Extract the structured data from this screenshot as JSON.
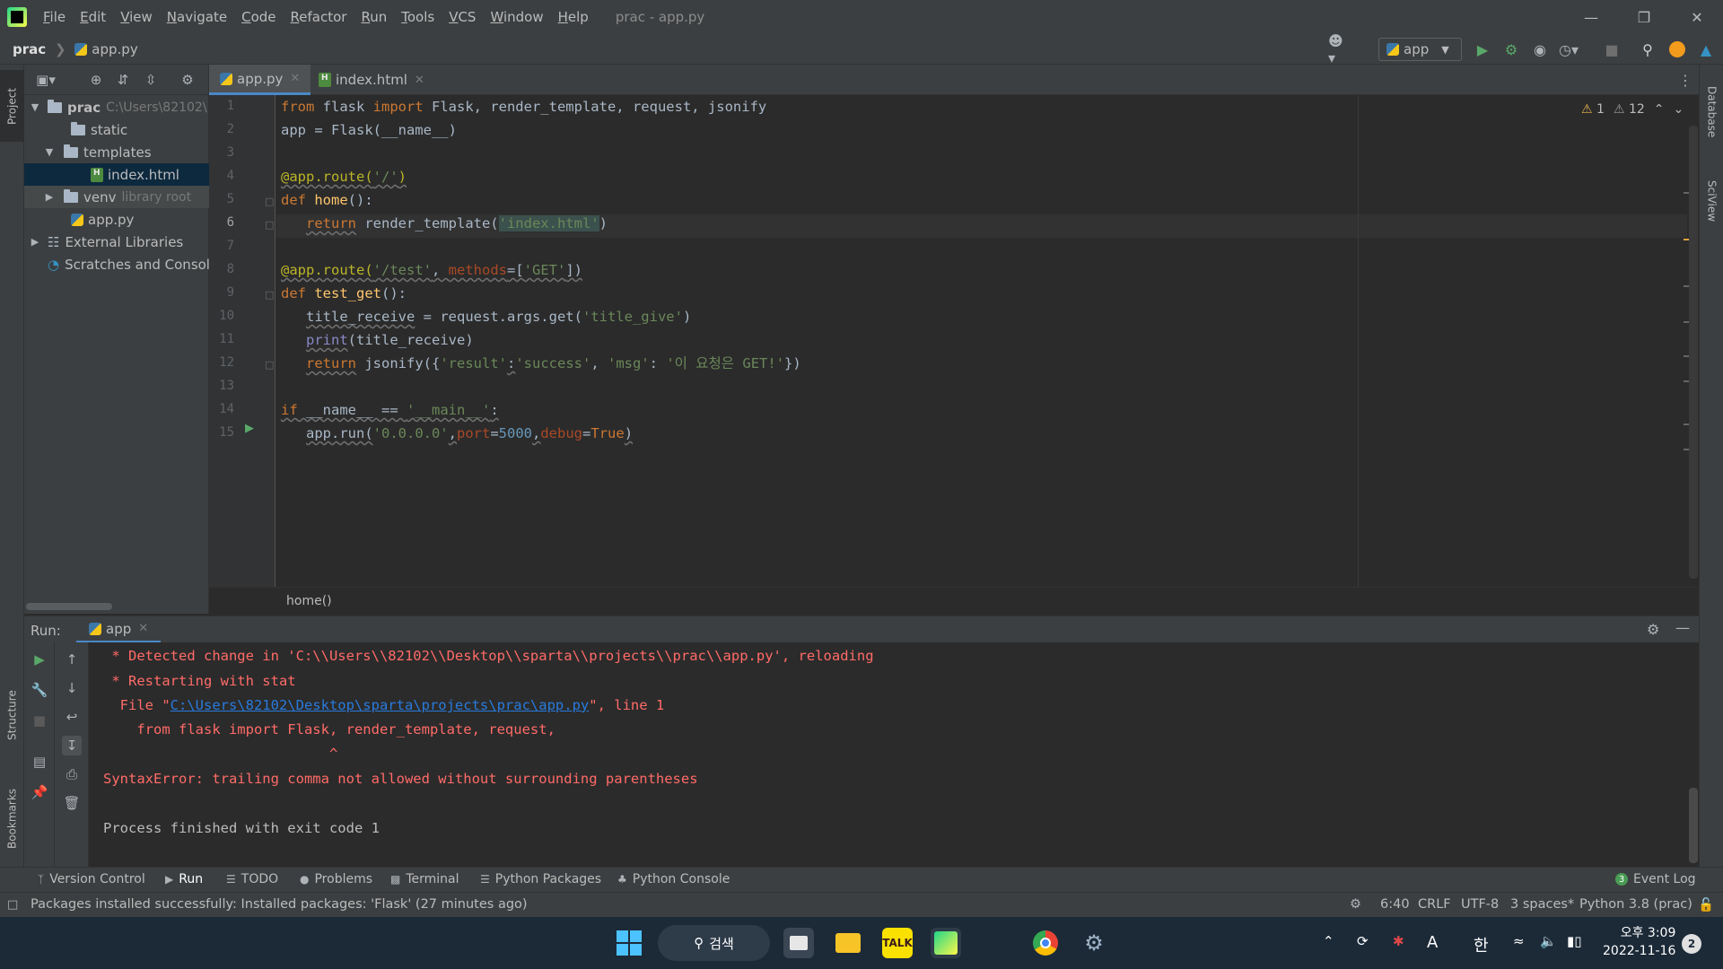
{
  "menu": [
    "File",
    "Edit",
    "View",
    "Navigate",
    "Code",
    "Refactor",
    "Run",
    "Tools",
    "VCS",
    "Window",
    "Help"
  ],
  "window_title": "prac - app.py",
  "navbar": {
    "project": "prac",
    "file": "app.py",
    "run_config": "app"
  },
  "left_strip": {
    "project": "Project",
    "structure": "Structure",
    "bookmarks": "Bookmarks"
  },
  "right_strip": {
    "database": "Database",
    "sciview": "SciView"
  },
  "tree": {
    "root": "prac",
    "root_path": "C:\\Users\\82102\\",
    "static": "static",
    "templates": "templates",
    "index": "index.html",
    "venv": "venv",
    "venv_note": "library root",
    "app": "app.py",
    "ext": "External Libraries",
    "scratch": "Scratches and Consoles"
  },
  "tabs": [
    "app.py",
    "index.html"
  ],
  "line_numbers": [
    "1",
    "2",
    "3",
    "4",
    "5",
    "6",
    "7",
    "8",
    "9",
    "10",
    "11",
    "12",
    "13",
    "14",
    "15"
  ],
  "code": {
    "l1": [
      "from",
      " flask ",
      "import",
      " Flask, render_template, request, jsonify"
    ],
    "l2": "app = Flask(__name__)",
    "l4": [
      "@app.route(",
      "'/'",
      ")"
    ],
    "l5": [
      "def",
      " ",
      "home",
      "():"
    ],
    "l6": [
      "return",
      " render_template(",
      "'index.html'",
      ")"
    ],
    "l8": [
      "@app.route(",
      "'/test'",
      ", ",
      "methods",
      "=[",
      "'GET'",
      "])"
    ],
    "l9": [
      "def",
      " ",
      "test_get",
      "():"
    ],
    "l10": [
      "title_receive",
      " = request.args.get(",
      "'title_give'",
      ")"
    ],
    "l11": [
      "print",
      "(title_receive)"
    ],
    "l12": [
      "return",
      " jsonify({",
      "'result'",
      ":",
      "'success'",
      ", ",
      "'msg'",
      ": ",
      "'이 요청은 GET!'",
      "})"
    ],
    "l14": [
      "if",
      " __name__ == ",
      "'__main__'",
      ":"
    ],
    "l15": [
      "app.run(",
      "'0.0.0.0'",
      ",",
      "port",
      "=",
      "5000",
      ",",
      "debug",
      "=",
      "True",
      ")"
    ]
  },
  "inspections": {
    "errors": "1",
    "warnings": "12"
  },
  "breadcrumb": "home()",
  "run": {
    "label": "Run:",
    "tab": "app"
  },
  "console": [
    " * Detected change in 'C:\\\\Users\\\\82102\\\\Desktop\\\\sparta\\\\projects\\\\prac\\\\app.py', reloading",
    " * Restarting with stat",
    "  File \"",
    "C:\\Users\\82102\\Desktop\\sparta\\projects\\prac\\app.py",
    "\", line 1",
    "    from flask import Flask, render_template, request,",
    "                           ^",
    "SyntaxError: trailing comma not allowed without surrounding parentheses",
    "Process finished with exit code 1"
  ],
  "tooltabs": [
    "Version Control",
    "Run",
    "TODO",
    "Problems",
    "Terminal",
    "Python Packages",
    "Python Console",
    "Event Log"
  ],
  "event_log_count": "3",
  "status": {
    "message": "Packages installed successfully: Installed packages: 'Flask' (27 minutes ago)",
    "position": "6:40",
    "line_sep": "CRLF",
    "encoding": "UTF-8",
    "indent": "3 spaces*",
    "interpreter": "Python 3.8 (prac)"
  },
  "taskbar": {
    "search": "검색",
    "ime_a": "A",
    "ime_han": "한",
    "time": "오후 3:09",
    "date": "2022-11-16",
    "notifications": "2"
  },
  "colors": {
    "accent": "#4a88c7",
    "error": "#ff6b68",
    "link": "#287bde",
    "keyword": "#cc7832",
    "string": "#6a8759"
  }
}
